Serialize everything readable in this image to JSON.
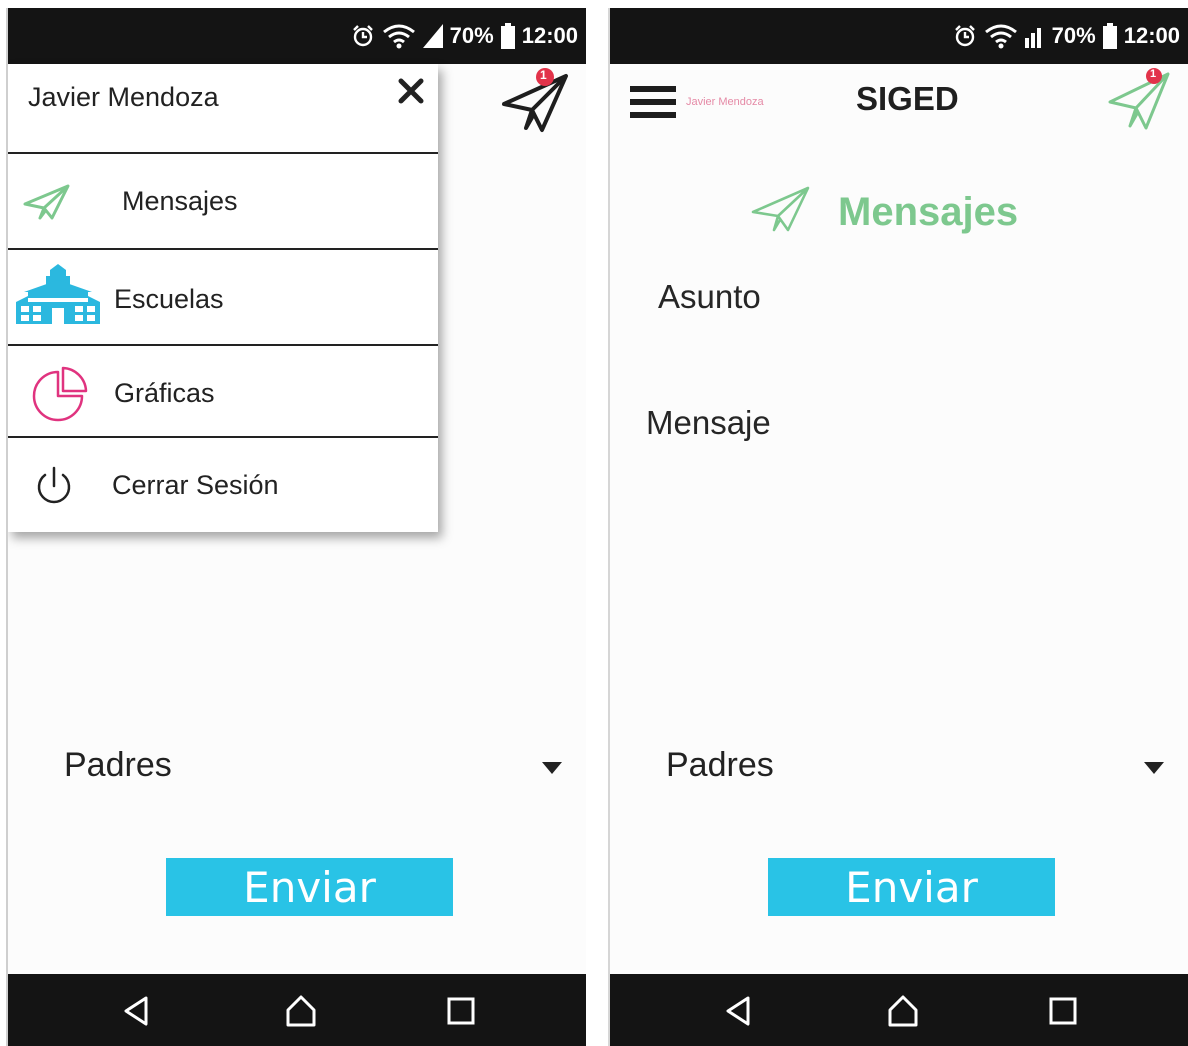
{
  "status_bar": {
    "battery": "70%",
    "time": "12:00"
  },
  "drawer": {
    "user_name": "Javier Mendoza",
    "items": [
      {
        "label": "Mensajes",
        "icon": "paper-plane-icon"
      },
      {
        "label": "Escuelas",
        "icon": "school-building-icon"
      },
      {
        "label": "Gráficas",
        "icon": "pie-chart-icon"
      },
      {
        "label": "Cerrar Sesión",
        "icon": "power-icon"
      }
    ]
  },
  "header": {
    "title": "SIGED",
    "user_name": "Javier Mendoza",
    "notification_count": "1"
  },
  "page": {
    "heading": "Mensajes"
  },
  "form": {
    "subject_placeholder": "Asunto",
    "message_placeholder": "Mensaje",
    "recipient_selected": "Padres",
    "send_label": "Enviar"
  },
  "colors": {
    "accent_green": "#7dc88e",
    "send_button": "#29c3e6",
    "school_icon": "#2bb8df",
    "chart_icon": "#e0337f",
    "notification_badge": "#e2334a"
  }
}
